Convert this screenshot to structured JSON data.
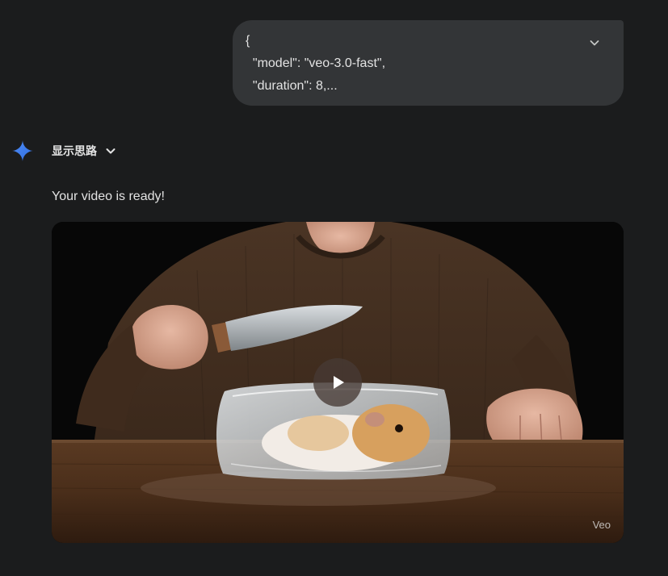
{
  "prompt": {
    "lines": [
      "{",
      "  \"model\": \"veo-3.0-fast\",",
      "  \"duration\": 8,..."
    ],
    "expand_icon": "chevron-down-icon"
  },
  "response": {
    "avatar_icon": "gemini-sparkle-icon",
    "thoughts_label": "显示思路",
    "thoughts_icon": "chevron-down-icon",
    "message": "Your video is ready!",
    "video": {
      "watermark": "Veo",
      "play_icon": "play-icon"
    }
  },
  "colors": {
    "background": "#1b1c1d",
    "bubble": "#333537",
    "text": "#e3e3e3",
    "gemini_blue": "#4285f4"
  }
}
